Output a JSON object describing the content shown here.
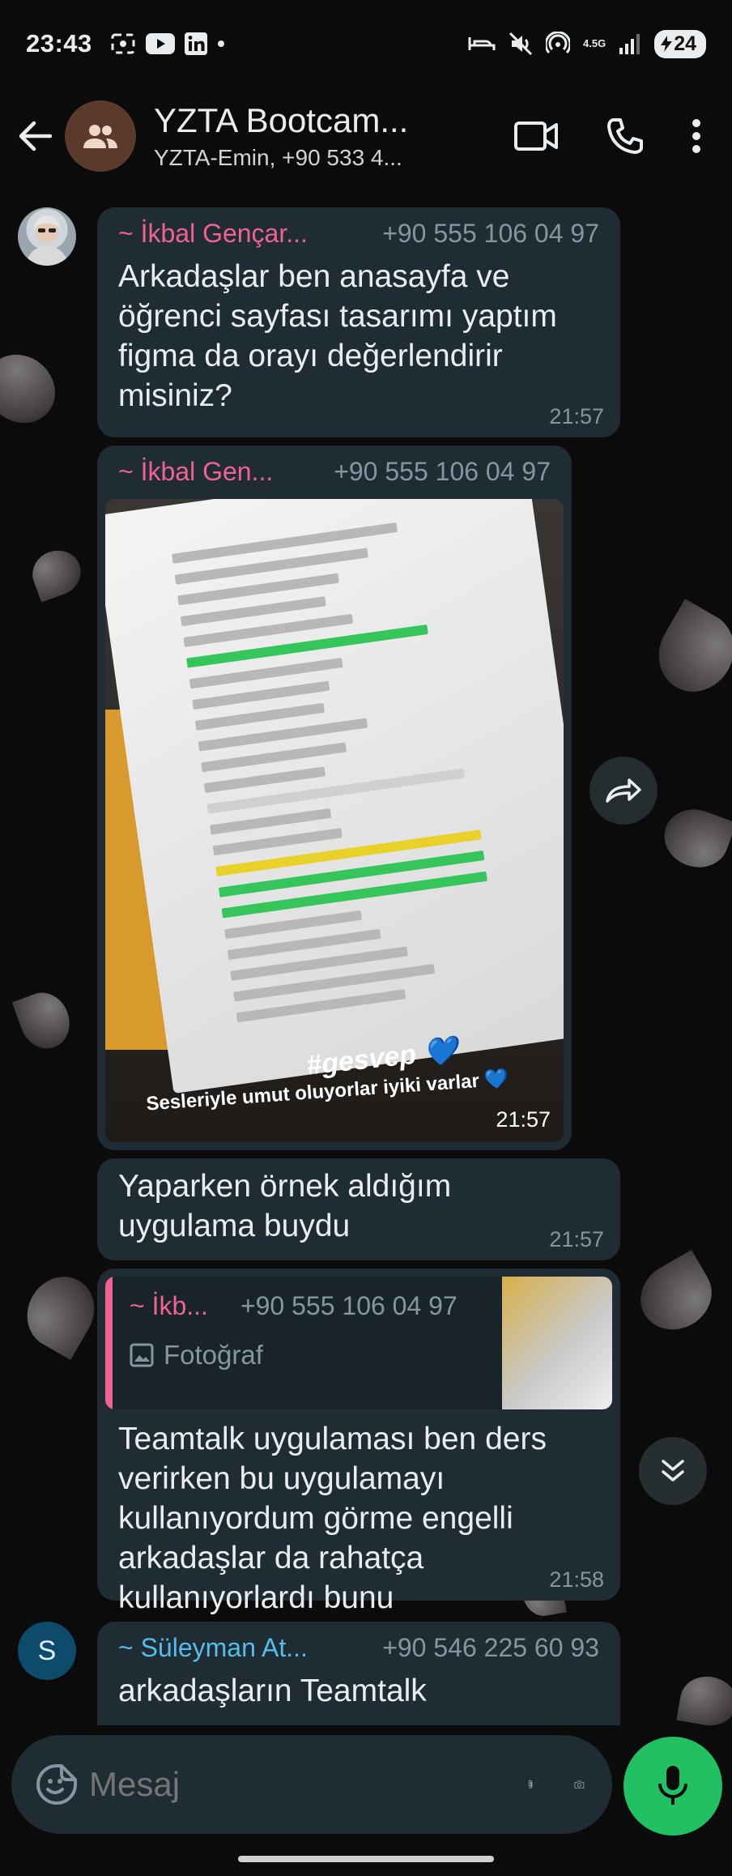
{
  "status_bar": {
    "time": "23:43",
    "network_label": "4.5G",
    "battery": "24"
  },
  "header": {
    "title": "YZTA Bootcam...",
    "subtitle": "YZTA-Emin, +90 533 4..."
  },
  "messages": [
    {
      "sender": "~ İkbal Gençar...",
      "phone": "+90 555 106 04 97",
      "text": "Arkadaşlar ben anasayfa ve öğrenci sayfası tasarımı yaptım figma da orayı değerlendirir misiniz?",
      "time": "21:57"
    },
    {
      "sender": "~ İkbal Gen...",
      "phone": "+90 555 106 04 97",
      "image_caption": "Sesleriyle umut oluyorlar iyiki varlar 💙",
      "image_hashtag": "#gesvep 💙",
      "time": "21:57"
    },
    {
      "text": "Yaparken örnek aldığım uygulama buydu",
      "time": "21:57"
    },
    {
      "quote_sender": "~ İkb...",
      "quote_phone": "+90 555 106 04 97",
      "quote_label": "Fotoğraf",
      "text": "Teamtalk uygulaması ben ders verirken bu uygulamayı kullanıyordum görme engelli arkadaşlar da rahatça kullanıyorlardı bunu",
      "time": "21:58"
    },
    {
      "avatar_letter": "S",
      "sender": "~ Süleyman At...",
      "phone": "+90 546 225 60 93",
      "text": "arkadaşların Teamtalk"
    }
  ],
  "composer": {
    "placeholder": "Mesaj"
  },
  "colors": {
    "bubble": "#1f2c33",
    "sender_pink": "#f06292",
    "sender_blue": "#53bdeb",
    "accent_green": "#21c063"
  }
}
